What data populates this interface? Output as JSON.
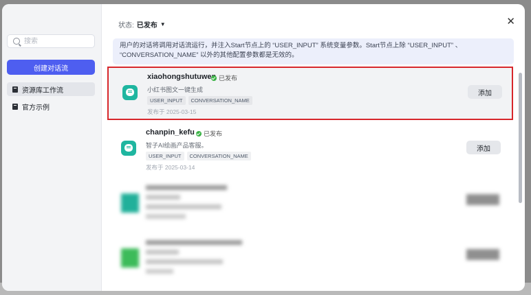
{
  "sidebar": {
    "search_placeholder": "搜索",
    "create_button": "创建对话流",
    "items": [
      {
        "label": "资源库工作流",
        "active": true
      },
      {
        "label": "官方示例",
        "active": false
      }
    ]
  },
  "header": {
    "status_label": "状态:",
    "status_value": "已发布",
    "close_icon": "close-icon"
  },
  "notice": {
    "line1": "用户的对话将调用对话流运行，并注入Start节点上的 “USER_INPUT” 系统变量参数。Start节点上除 “USER_INPUT” 、",
    "line2": "“CONVERSATION_NAME” 以外的其他配置参数都是无效的。"
  },
  "workflows": [
    {
      "name": "xiaohongshutuwen",
      "status": "已发布",
      "description": "小红书图文一键生成",
      "tags": [
        "USER_INPUT",
        "CONVERSATION_NAME"
      ],
      "published": "发布于 2025-03-15",
      "add_label": "添加",
      "highlighted": true
    },
    {
      "name": "chanpin_kefu",
      "status": "已发布",
      "description": "智子AI绘画产品客服。",
      "tags": [
        "USER_INPUT",
        "CONVERSATION_NAME"
      ],
      "published": "发布于 2025-03-14",
      "add_label": "添加",
      "highlighted": false
    }
  ],
  "colors": {
    "accent": "#4e5ef0",
    "highlight_border": "#d7262b",
    "published_green": "#3bb346",
    "app_icon": "#1fb6a0"
  }
}
